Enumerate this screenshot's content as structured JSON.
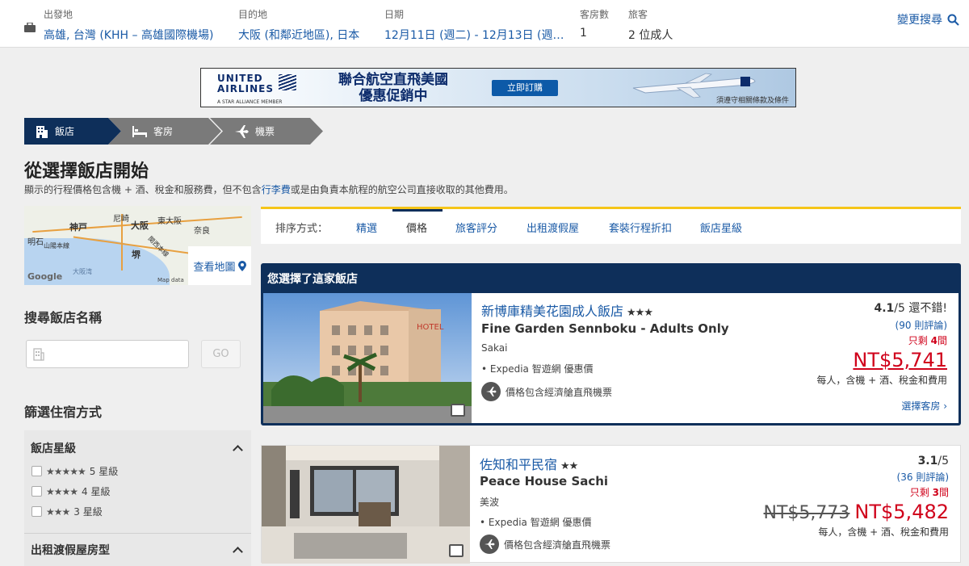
{
  "search": {
    "origin_label": "出發地",
    "origin_value": "高雄, 台灣 (KHH – 高雄國際機場)",
    "dest_label": "目的地",
    "dest_value": "大阪 (和鄰近地區), 日本",
    "date_label": "日期",
    "date_value": "12月11日 (週二) - 12月13日 (週…",
    "rooms_label": "客房數",
    "rooms_value": "1",
    "guests_label": "旅客",
    "guests_value": "2 位成人",
    "modify_label": "變更搜尋"
  },
  "banner": {
    "brand_line1": "UNITED",
    "brand_line2": "AIRLINES",
    "brand_tag": "A STAR ALLIANCE MEMBER",
    "headline_1": "聯合航空直飛美國",
    "headline_2": "優惠促銷中",
    "cta": "立即訂購",
    "fine_print": "須遵守相關條款及條件"
  },
  "steps": [
    "飯店",
    "客房",
    "機票"
  ],
  "page": {
    "title": "從選擇飯店開始",
    "disclaimer_pre": "顯示的行程價格包含機 + 酒、稅金和服務費，但不包含",
    "disclaimer_link": "行李費",
    "disclaimer_post": "或是由負責本航程的航空公司直接收取的其他費用。"
  },
  "map": {
    "labels": [
      "神戸",
      "尼崎",
      "大阪",
      "東大阪",
      "奈良",
      "明石",
      "堺",
      "山陽本線",
      "関西本線",
      "大阪湾"
    ],
    "view_map": "查看地圖",
    "google": "Google",
    "map_data": "Map data"
  },
  "sidebar": {
    "search_name_heading": "搜尋飯店名稱",
    "go_label": "GO",
    "filter_heading": "篩選住宿方式",
    "star_heading": "飯店星級",
    "star_options": [
      {
        "stars": "★★★★★",
        "label": "5 星級"
      },
      {
        "stars": "★★★★",
        "label": "4 星級"
      },
      {
        "stars": "★★★",
        "label": "3 星級"
      }
    ],
    "rental_heading": "出租渡假屋房型"
  },
  "sort": {
    "label": "排序方式：",
    "tabs": [
      "精選",
      "價格",
      "旅客評分",
      "出租渡假屋",
      "套裝行程折扣",
      "飯店星級"
    ],
    "active_index": 1
  },
  "selected_heading": "您選擇了這家飯店",
  "hotels": [
    {
      "name": "新博庫精美花園成人飯店",
      "stars": "★★★",
      "name_en": "Fine Garden Sennboku - Adults Only",
      "city": "Sakai",
      "deal": "• Expedia 智遊網 優惠價",
      "flight": "價格包含經濟艙直飛機票",
      "rating": "4.1",
      "rating_scale": "/5",
      "rating_word": "還不錯!",
      "reviews": "(90 則評論)",
      "left_pre": "只剩 ",
      "left_num": "4",
      "left_post": "間",
      "price": "NT$5,741",
      "per": "每人，含機 + 酒、稅金和費用",
      "choose": "選擇客房"
    },
    {
      "name": "佐知和平民宿",
      "stars": "★★",
      "name_en": "Peace House Sachi",
      "city": "美波",
      "deal": "• Expedia 智遊網 優惠價",
      "flight": "價格包含經濟艙直飛機票",
      "rating": "3.1",
      "rating_scale": "/5",
      "reviews": "(36 則評論)",
      "left_pre": "只剩 ",
      "left_num": "3",
      "left_post": "間",
      "old_price": "NT$5,773",
      "price": "NT$5,482",
      "per": "每人，含機 + 酒、稅金和費用"
    }
  ],
  "colors": {
    "brand_navy": "#0e2f5a",
    "link_blue": "#1a5aa6",
    "price_red": "#d0021b",
    "accent_yellow": "#f5c518"
  }
}
